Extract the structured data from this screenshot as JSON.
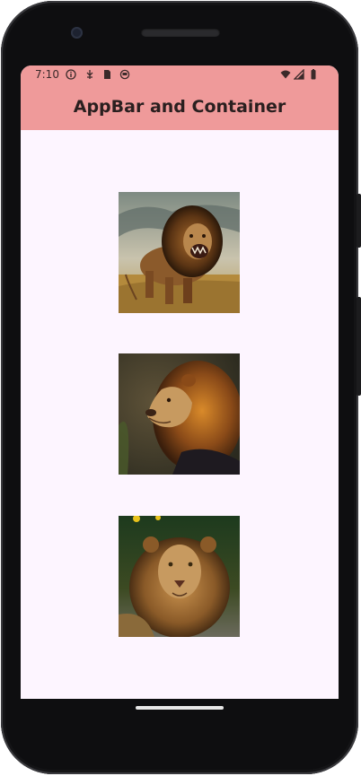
{
  "status_bar": {
    "time": "7:10",
    "left_icons": [
      "info-icon",
      "usb-debug-icon",
      "sd-card-icon",
      "sync-icon"
    ],
    "right_icons": [
      "wifi-icon",
      "signal-icon",
      "battery-icon"
    ]
  },
  "app_bar": {
    "title": "AppBar and Container",
    "color": "#ef9a9a"
  },
  "body": {
    "background": "#fdf5ff",
    "images": [
      {
        "subject": "roaring-lion"
      },
      {
        "subject": "lion-profile"
      },
      {
        "subject": "lion-portrait"
      }
    ]
  }
}
